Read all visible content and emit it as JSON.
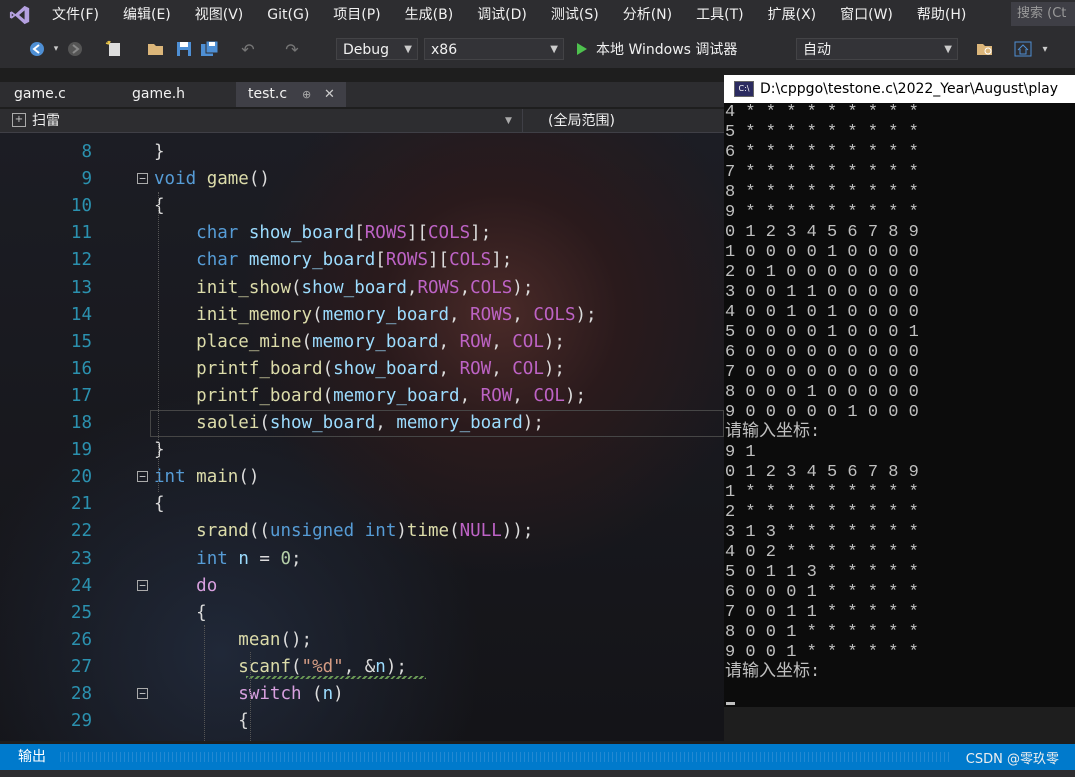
{
  "menu": [
    "文件(F)",
    "编辑(E)",
    "视图(V)",
    "Git(G)",
    "项目(P)",
    "生成(B)",
    "调试(D)",
    "测试(S)",
    "分析(N)",
    "工具(T)",
    "扩展(X)",
    "窗口(W)",
    "帮助(H)"
  ],
  "search_placeholder": "搜索 (Ct",
  "toolbar": {
    "config": "Debug",
    "platform": "x86",
    "run_label": "本地 Windows 调试器",
    "auto_label": "自动"
  },
  "tabs": [
    "game.c",
    "game.h",
    "test.c"
  ],
  "active_tab": "test.c",
  "tab_pin": "⊕",
  "tab_close": "✕",
  "navbar": {
    "project": "扫雷",
    "scope": "(全局范围)"
  },
  "code_lines": [
    {
      "n": "8",
      "t": "}"
    },
    {
      "n": "9",
      "t": "void game()"
    },
    {
      "n": "10",
      "t": "{"
    },
    {
      "n": "11",
      "t": "    char show_board[ROWS][COLS];"
    },
    {
      "n": "12",
      "t": "    char memory_board[ROWS][COLS];"
    },
    {
      "n": "13",
      "t": "    init_show(show_board,ROWS,COLS);"
    },
    {
      "n": "14",
      "t": "    init_memory(memory_board, ROWS, COLS);"
    },
    {
      "n": "15",
      "t": "    place_mine(memory_board, ROW, COL);"
    },
    {
      "n": "16",
      "t": "    printf_board(show_board, ROW, COL);"
    },
    {
      "n": "17",
      "t": "    printf_board(memory_board, ROW, COL);"
    },
    {
      "n": "18",
      "t": "    saolei(show_board, memory_board);"
    },
    {
      "n": "19",
      "t": "}"
    },
    {
      "n": "20",
      "t": "int main()"
    },
    {
      "n": "21",
      "t": "{"
    },
    {
      "n": "22",
      "t": "    srand((unsigned int)time(NULL));"
    },
    {
      "n": "23",
      "t": "    int n = 0;"
    },
    {
      "n": "24",
      "t": "    do"
    },
    {
      "n": "25",
      "t": "    {"
    },
    {
      "n": "26",
      "t": "        mean();"
    },
    {
      "n": "27",
      "t": "        scanf(\"%d\", &n);"
    },
    {
      "n": "28",
      "t": "        switch (n)"
    },
    {
      "n": "29",
      "t": "        {"
    }
  ],
  "console": {
    "title": "D:\\cppgo\\testone.c\\2022_Year\\August\\play",
    "lines": [
      "4 * * * * * * * * *",
      "5 * * * * * * * * *",
      "6 * * * * * * * * *",
      "7 * * * * * * * * *",
      "8 * * * * * * * * *",
      "9 * * * * * * * * *",
      "0 1 2 3 4 5 6 7 8 9",
      "1 0 0 0 0 1 0 0 0 0",
      "2 0 1 0 0 0 0 0 0 0",
      "3 0 0 1 1 0 0 0 0 0",
      "4 0 0 1 0 1 0 0 0 0",
      "5 0 0 0 0 1 0 0 0 1",
      "6 0 0 0 0 0 0 0 0 0",
      "7 0 0 0 0 0 0 0 0 0",
      "8 0 0 0 1 0 0 0 0 0",
      "9 0 0 0 0 0 1 0 0 0",
      "请输入坐标:",
      "9 1",
      "0 1 2 3 4 5 6 7 8 9",
      "1 * * * * * * * * *",
      "2 * * * * * * * * *",
      "3 1 3 * * * * * * *",
      "4 0 2 * * * * * * *",
      "5 0 1 1 3 * * * * *",
      "6 0 0 0 1 * * * * *",
      "7 0 0 1 1 * * * * *",
      "8 0 0 1 * * * * * *",
      "9 0 0 1 * * * * * *",
      "请输入坐标:"
    ]
  },
  "output_label": "输出",
  "watermark": "CSDN @零玖零",
  "colors": {
    "keyword": "#569cd6",
    "function": "#dcdcaa",
    "macro": "#bd63c5",
    "variable": "#9cdcfe",
    "string": "#d69d85",
    "number": "#b5cea8",
    "line_number": "#2b91af",
    "status_bar": "#007acc"
  }
}
